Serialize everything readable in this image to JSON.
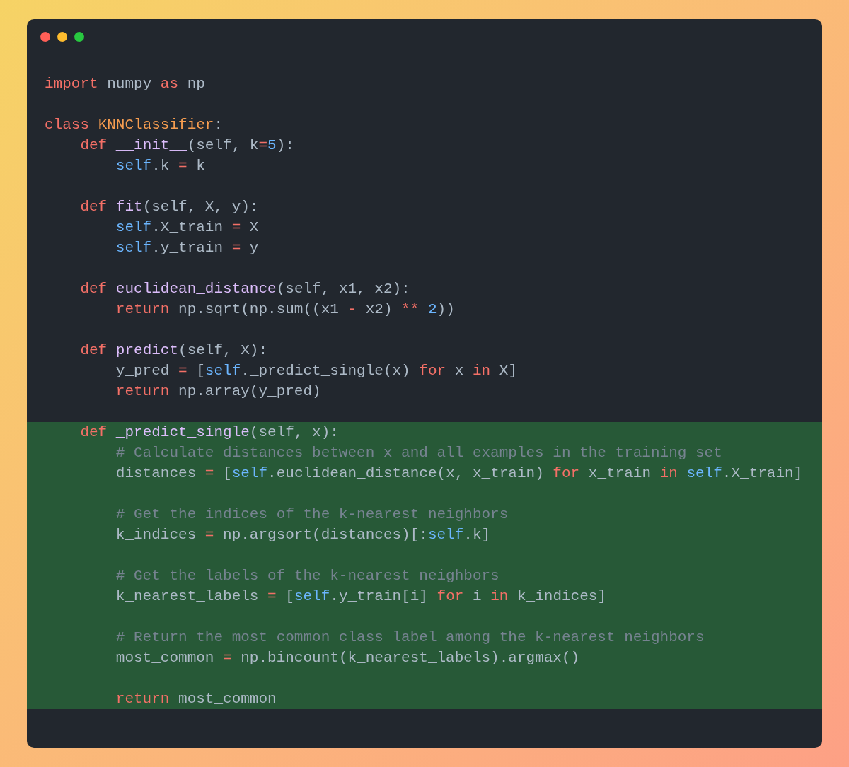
{
  "window": {
    "controls": [
      {
        "color": "#ff5f57"
      },
      {
        "color": "#febc2e"
      },
      {
        "color": "#28c840"
      }
    ]
  },
  "code": {
    "sections": [
      {
        "highlighted": false,
        "groups": [
          [
            [
              {
                "kind": "keyword",
                "text": "import"
              },
              {
                "kind": "plain",
                "text": " numpy "
              },
              {
                "kind": "keyword",
                "text": "as"
              },
              {
                "kind": "plain",
                "text": " np"
              }
            ]
          ],
          [
            [
              {
                "kind": "keyword",
                "text": "class "
              },
              {
                "kind": "class",
                "text": "KNNClassifier"
              },
              {
                "kind": "plain",
                "text": ":"
              }
            ],
            [
              {
                "kind": "keyword",
                "text": "    def "
              },
              {
                "kind": "function",
                "text": "__init__"
              },
              {
                "kind": "plain",
                "text": "(self, k"
              },
              {
                "kind": "operator",
                "text": "="
              },
              {
                "kind": "number",
                "text": "5"
              },
              {
                "kind": "plain",
                "text": "):"
              }
            ],
            [
              {
                "kind": "self",
                "text": "        self"
              },
              {
                "kind": "plain",
                "text": ".k "
              },
              {
                "kind": "operator",
                "text": "="
              },
              {
                "kind": "plain",
                "text": " k"
              }
            ]
          ],
          [
            [
              {
                "kind": "keyword",
                "text": "    def "
              },
              {
                "kind": "function",
                "text": "fit"
              },
              {
                "kind": "plain",
                "text": "(self, X, y):"
              }
            ],
            [
              {
                "kind": "self",
                "text": "        self"
              },
              {
                "kind": "plain",
                "text": ".X_train "
              },
              {
                "kind": "operator",
                "text": "="
              },
              {
                "kind": "plain",
                "text": " X"
              }
            ],
            [
              {
                "kind": "self",
                "text": "        self"
              },
              {
                "kind": "plain",
                "text": ".y_train "
              },
              {
                "kind": "operator",
                "text": "="
              },
              {
                "kind": "plain",
                "text": " y"
              }
            ]
          ],
          [
            [
              {
                "kind": "keyword",
                "text": "    def "
              },
              {
                "kind": "function",
                "text": "euclidean_distance"
              },
              {
                "kind": "plain",
                "text": "(self, x1, x2):"
              }
            ],
            [
              {
                "kind": "keyword",
                "text": "        return"
              },
              {
                "kind": "plain",
                "text": " np.sqrt(np.sum((x1 "
              },
              {
                "kind": "operator",
                "text": "-"
              },
              {
                "kind": "plain",
                "text": " x2) "
              },
              {
                "kind": "operator",
                "text": "** "
              },
              {
                "kind": "number",
                "text": "2"
              },
              {
                "kind": "plain",
                "text": "))"
              }
            ]
          ],
          [
            [
              {
                "kind": "keyword",
                "text": "    def "
              },
              {
                "kind": "function",
                "text": "predict"
              },
              {
                "kind": "plain",
                "text": "(self, X):"
              }
            ],
            [
              {
                "kind": "plain",
                "text": "        y_pred "
              },
              {
                "kind": "operator",
                "text": "="
              },
              {
                "kind": "plain",
                "text": " ["
              },
              {
                "kind": "self",
                "text": "self"
              },
              {
                "kind": "plain",
                "text": "._predict_single(x) "
              },
              {
                "kind": "keyword",
                "text": "for"
              },
              {
                "kind": "plain",
                "text": " x "
              },
              {
                "kind": "keyword",
                "text": "in"
              },
              {
                "kind": "plain",
                "text": " X]"
              }
            ],
            [
              {
                "kind": "keyword",
                "text": "        return"
              },
              {
                "kind": "plain",
                "text": " np.array(y_pred)"
              }
            ]
          ]
        ]
      },
      {
        "highlighted": true,
        "groups": [
          [
            [
              {
                "kind": "keyword",
                "text": "    def "
              },
              {
                "kind": "function",
                "text": "_predict_single"
              },
              {
                "kind": "plain",
                "text": "(self, x):"
              }
            ],
            [
              {
                "kind": "comment",
                "text": "        # Calculate distances between x and all examples in the training set"
              }
            ],
            [
              {
                "kind": "plain",
                "text": "        distances "
              },
              {
                "kind": "operator",
                "text": "="
              },
              {
                "kind": "plain",
                "text": " ["
              },
              {
                "kind": "self",
                "text": "self"
              },
              {
                "kind": "plain",
                "text": ".euclidean_distance(x, x_train) "
              },
              {
                "kind": "keyword",
                "text": "for"
              },
              {
                "kind": "plain",
                "text": " x_train "
              },
              {
                "kind": "keyword",
                "text": "in "
              },
              {
                "kind": "self",
                "text": "self"
              },
              {
                "kind": "plain",
                "text": ".X_train]"
              }
            ]
          ],
          [
            [
              {
                "kind": "comment",
                "text": "        # Get the indices of the k-nearest neighbors"
              }
            ],
            [
              {
                "kind": "plain",
                "text": "        k_indices "
              },
              {
                "kind": "operator",
                "text": "="
              },
              {
                "kind": "plain",
                "text": " np.argsort(distances)[:"
              },
              {
                "kind": "self",
                "text": "self"
              },
              {
                "kind": "plain",
                "text": ".k]"
              }
            ]
          ],
          [
            [
              {
                "kind": "comment",
                "text": "        # Get the labels of the k-nearest neighbors"
              }
            ],
            [
              {
                "kind": "plain",
                "text": "        k_nearest_labels "
              },
              {
                "kind": "operator",
                "text": "="
              },
              {
                "kind": "plain",
                "text": " ["
              },
              {
                "kind": "self",
                "text": "self"
              },
              {
                "kind": "plain",
                "text": ".y_train[i] "
              },
              {
                "kind": "keyword",
                "text": "for"
              },
              {
                "kind": "plain",
                "text": " i "
              },
              {
                "kind": "keyword",
                "text": "in"
              },
              {
                "kind": "plain",
                "text": " k_indices]"
              }
            ]
          ],
          [
            [
              {
                "kind": "comment",
                "text": "        # Return the most common class label among the k-nearest neighbors"
              }
            ],
            [
              {
                "kind": "plain",
                "text": "        most_common "
              },
              {
                "kind": "operator",
                "text": "="
              },
              {
                "kind": "plain",
                "text": " np.bincount(k_nearest_labels).argmax()"
              }
            ]
          ],
          [
            [
              {
                "kind": "keyword",
                "text": "        return"
              },
              {
                "kind": "plain",
                "text": " most_common"
              }
            ]
          ]
        ]
      }
    ]
  }
}
